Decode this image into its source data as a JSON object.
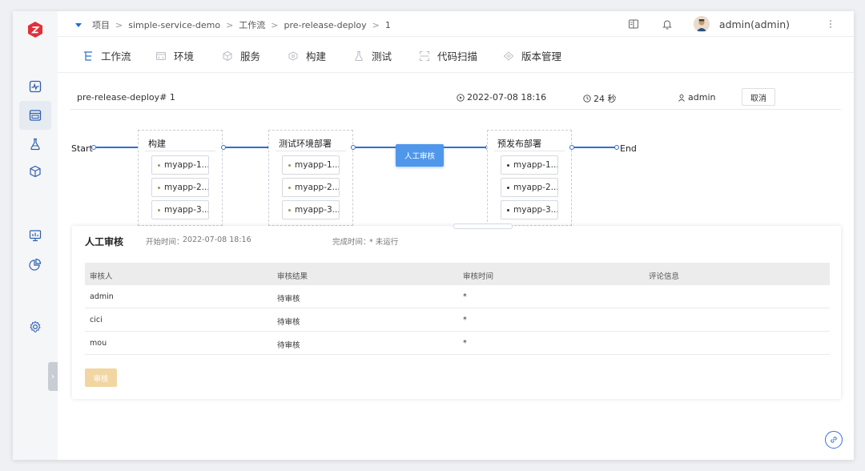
{
  "breadcrumb": {
    "items": [
      "项目",
      "simple-service-demo",
      "工作流",
      "pre-release-deploy",
      "1"
    ],
    "separator": ">"
  },
  "topbar": {
    "user": "admin(admin)"
  },
  "sidebar": {
    "icons": [
      "logo-icon",
      "monitor-wave-icon",
      "calendar-icon",
      "flask-icon",
      "cube-icon",
      "chart-screen-icon",
      "pie-chart-icon",
      "gear-icon"
    ],
    "active_index": 1
  },
  "tabs": [
    {
      "label": "工作流",
      "icon": "workflow-icon"
    },
    {
      "label": "环境",
      "icon": "environment-icon"
    },
    {
      "label": "服务",
      "icon": "service-icon"
    },
    {
      "label": "构建",
      "icon": "build-icon"
    },
    {
      "label": "测试",
      "icon": "test-icon"
    },
    {
      "label": "代码扫描",
      "icon": "scan-icon"
    },
    {
      "label": "版本管理",
      "icon": "version-icon"
    }
  ],
  "run": {
    "name": "pre-release-deploy# 1",
    "started": "2022-07-08 18:16",
    "duration": "24 秒",
    "user": "admin",
    "cancel_label": "取消"
  },
  "flow": {
    "start_label": "Start",
    "end_label": "End",
    "stages": [
      {
        "title": "构建",
        "jobs": [
          "myapp-1...",
          "myapp-2...",
          "myapp-3..."
        ]
      },
      {
        "title": "测试环境部署",
        "jobs": [
          "myapp-1...",
          "myapp-2...",
          "myapp-3..."
        ]
      },
      {
        "title": "预发布部署",
        "jobs": [
          "myapp-1...",
          "myapp-2...",
          "myapp-3..."
        ]
      }
    ],
    "manual_label": "人工审核"
  },
  "approval": {
    "title": "人工审核",
    "start_label": "开始时间：",
    "start_value": "2022-07-08 18:16",
    "finish_label": "完成时间：",
    "finish_value": "* 未运行",
    "columns": [
      "审核人",
      "审核结果",
      "审核时间",
      "评论信息"
    ],
    "rows": [
      {
        "reviewer": "admin",
        "result": "待审核",
        "time": "*",
        "comment": ""
      },
      {
        "reviewer": "cici",
        "result": "待审核",
        "time": "*",
        "comment": ""
      },
      {
        "reviewer": "mou",
        "result": "待审核",
        "time": "*",
        "comment": ""
      }
    ],
    "review_button": "审核"
  },
  "colors": {
    "accent": "#2f6fd0",
    "manual_node": "#4f97ea",
    "review_button": "#f2d6a2",
    "logo": "#e0303a"
  }
}
